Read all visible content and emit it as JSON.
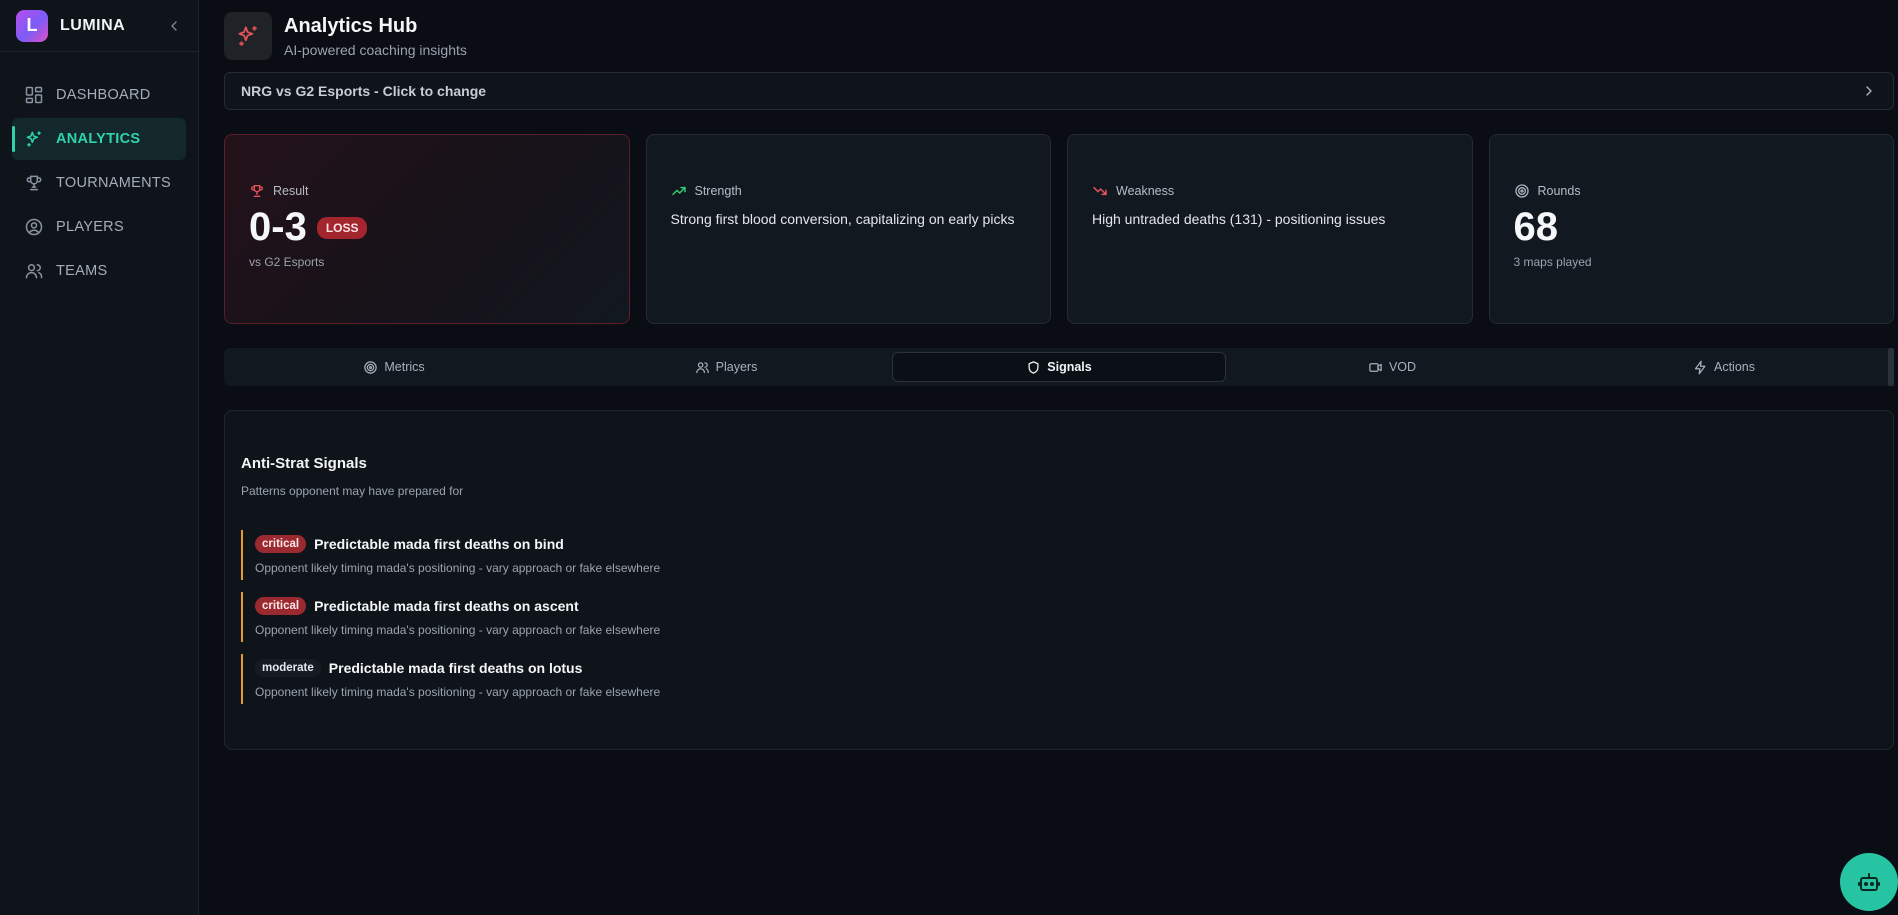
{
  "brand": {
    "name": "LUMINA",
    "logo_letter": "L"
  },
  "sidebar": {
    "items": [
      {
        "label": "DASHBOARD",
        "icon": "grid-icon"
      },
      {
        "label": "ANALYTICS",
        "icon": "sparkles-icon",
        "active": true
      },
      {
        "label": "TOURNAMENTS",
        "icon": "trophy-icon"
      },
      {
        "label": "PLAYERS",
        "icon": "user-circle-icon"
      },
      {
        "label": "TEAMS",
        "icon": "users-icon"
      }
    ]
  },
  "header": {
    "title": "Analytics Hub",
    "subtitle": "AI-powered coaching insights"
  },
  "match_selector": {
    "label": "NRG vs G2 Esports - Click to change"
  },
  "cards": {
    "result": {
      "label": "Result",
      "score": "0-3",
      "badge": "LOSS",
      "sub": "vs G2 Esports"
    },
    "strength": {
      "label": "Strength",
      "text": "Strong first blood conversion, capitalizing on early picks"
    },
    "weakness": {
      "label": "Weakness",
      "text": "High untraded deaths (131) - positioning issues"
    },
    "rounds": {
      "label": "Rounds",
      "value": "68",
      "sub": "3 maps played"
    }
  },
  "tabs": [
    {
      "label": "Metrics",
      "icon": "target-icon"
    },
    {
      "label": "Players",
      "icon": "users-icon"
    },
    {
      "label": "Signals",
      "icon": "shield-icon",
      "active": true
    },
    {
      "label": "VOD",
      "icon": "video-icon"
    },
    {
      "label": "Actions",
      "icon": "zap-icon"
    }
  ],
  "signals_panel": {
    "title": "Anti-Strat Signals",
    "subtitle": "Patterns opponent may have prepared for",
    "items": [
      {
        "severity": "critical",
        "title": "Predictable mada first deaths on bind",
        "description": "Opponent likely timing mada's positioning - vary approach or fake elsewhere"
      },
      {
        "severity": "critical",
        "title": "Predictable mada first deaths on ascent",
        "description": "Opponent likely timing mada's positioning - vary approach or fake elsewhere"
      },
      {
        "severity": "moderate",
        "title": "Predictable mada first deaths on lotus",
        "description": "Opponent likely timing mada's positioning - vary approach or fake elsewhere"
      }
    ]
  },
  "colors": {
    "accent": "#2fd3ad",
    "loss": "#a3252d",
    "strength": "#2fcf6f",
    "weakness": "#e8525a",
    "signal_border": "#e79a2e"
  }
}
